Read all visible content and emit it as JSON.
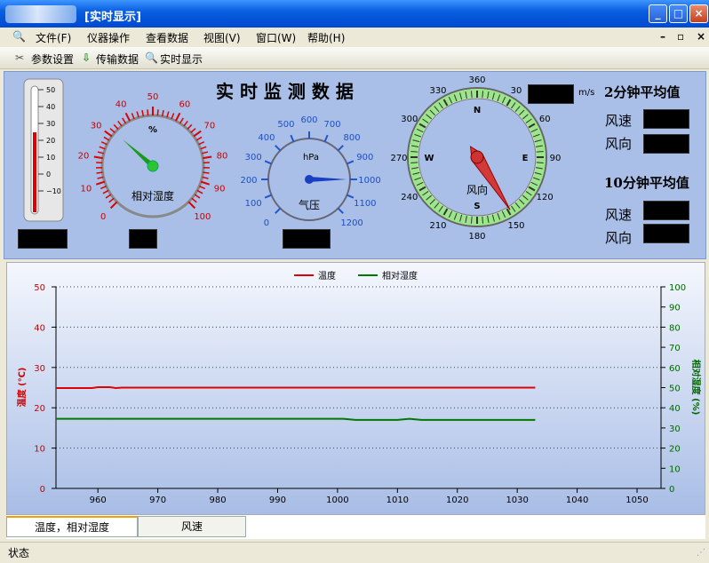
{
  "window": {
    "title": "[实时显示]"
  },
  "menu": [
    "文件(F)",
    "仪器操作",
    "查看数据",
    "视图(V)",
    "窗口(W)",
    "帮助(H)"
  ],
  "mdi_controls": [
    "–",
    "▫",
    "×"
  ],
  "toolbar": {
    "params": "参数设置",
    "transfer": "传输数据",
    "realtime": "实时显示"
  },
  "panel": {
    "title": "实 时 监 测 数 据",
    "thermo_ticks": [
      "50",
      "40",
      "30",
      "20",
      "10",
      "0",
      "−10"
    ],
    "humidity": {
      "unit": "%",
      "label": "相对湿度",
      "ticks": [
        "0",
        "10",
        "20",
        "30",
        "40",
        "50",
        "60",
        "70",
        "80",
        "90",
        "100"
      ],
      "value": 32
    },
    "pressure": {
      "unit": "hPa",
      "label": "气压",
      "ticks": [
        "0",
        "100",
        "200",
        "300",
        "400",
        "500",
        "600",
        "700",
        "800",
        "900",
        "1000",
        "1100",
        "1200"
      ],
      "value": 1000
    },
    "compass": {
      "label": "风向",
      "ticks": [
        "360",
        "30",
        "60",
        "90",
        "120",
        "150",
        "180",
        "210",
        "240",
        "270",
        "300",
        "330"
      ],
      "cardinals": [
        "N",
        "E",
        "S",
        "W"
      ],
      "direction_deg": 148
    },
    "speed_unit": "m/s",
    "avg2_title": "2分钟平均值",
    "avg10_title": "10分钟平均值",
    "wind_speed": "风速",
    "wind_dir": "风向"
  },
  "chart_data": {
    "type": "line",
    "legend": [
      "温度",
      "相对湿度"
    ],
    "xlim": [
      953,
      1054
    ],
    "xticks": [
      "960",
      "970",
      "980",
      "990",
      "1000",
      "1010",
      "1020",
      "1030",
      "1040",
      "1050"
    ],
    "ylim_left": [
      0,
      50
    ],
    "yticks_left": [
      "0",
      "10",
      "20",
      "30",
      "40",
      "50"
    ],
    "ylabel_left": "温度 (℃)",
    "ylim_right": [
      0,
      100
    ],
    "yticks_right": [
      "0",
      "10",
      "20",
      "30",
      "40",
      "50",
      "60",
      "70",
      "80",
      "90",
      "100"
    ],
    "ylabel_right": "相对湿度 (%)",
    "series": [
      {
        "name": "温度",
        "color": "#e00000",
        "axis": "left",
        "x": [
          953,
          959,
          960,
          962,
          963,
          964,
          966,
          1033
        ],
        "values": [
          24.9,
          24.9,
          25.1,
          25.1,
          24.9,
          25.0,
          25.0,
          25.0
        ]
      },
      {
        "name": "相对湿度",
        "color": "#007700",
        "axis": "right",
        "x": [
          953,
          1001,
          1003,
          1010,
          1012,
          1014,
          1016,
          1033
        ],
        "values": [
          34.5,
          34.5,
          34.0,
          34.0,
          34.5,
          34.0,
          34.0,
          34.0
        ]
      }
    ]
  },
  "tabs": [
    "温度，相对湿度",
    "风速"
  ],
  "status": "状态",
  "colors": {
    "title_bar": "#0a5fe0",
    "panel": "#a9bfe7",
    "temp": "#e00000",
    "humidity": "#007700"
  }
}
